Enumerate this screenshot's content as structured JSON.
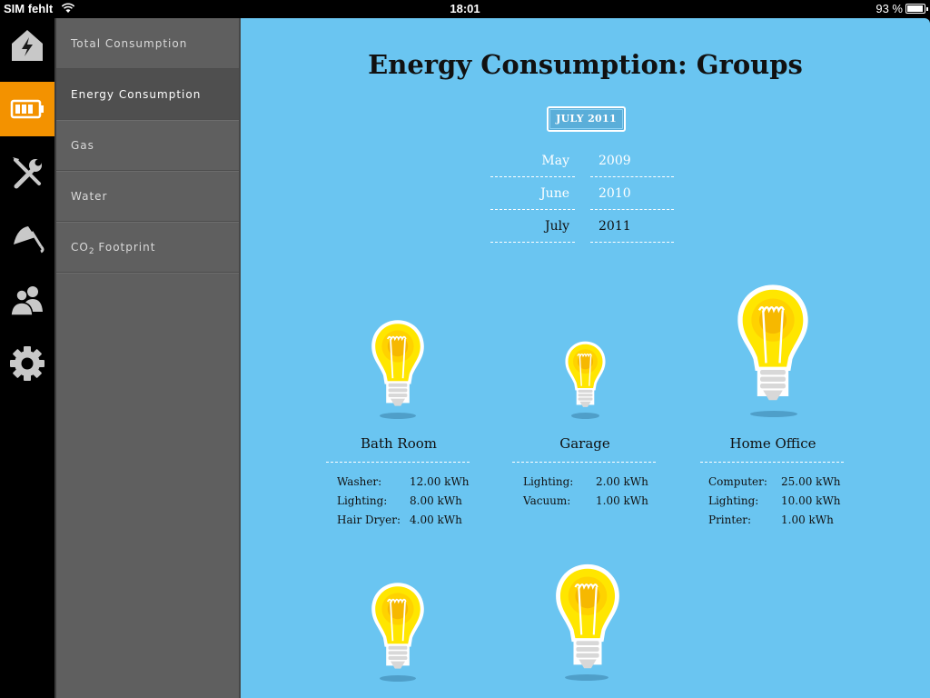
{
  "status_bar": {
    "carrier": "SIM fehlt",
    "time": "18:01",
    "battery_percent": "93 %",
    "battery_level": 0.93
  },
  "icon_rail": {
    "items": [
      {
        "icon": "house-lightning-icon",
        "active": false
      },
      {
        "icon": "battery-icon",
        "active": true
      },
      {
        "icon": "tools-icon",
        "active": false
      },
      {
        "icon": "shower-icon",
        "active": false
      },
      {
        "icon": "users-icon",
        "active": false
      },
      {
        "icon": "gear-icon",
        "active": false
      }
    ],
    "accent_color": "#f39200"
  },
  "submenu": {
    "items": [
      {
        "label": "Total Consumption",
        "active": false
      },
      {
        "label": "Energy Consumption",
        "active": true
      },
      {
        "label": "Gas",
        "active": false
      },
      {
        "label": "Water",
        "active": false
      },
      {
        "label_main": "CO",
        "label_sub": "2",
        "label_rest": " Footprint",
        "active": false
      }
    ]
  },
  "content": {
    "background_color": "#6ac5f1",
    "title": "Energy Consumption: Groups",
    "selected_period_button": "JULY 2011",
    "picker": {
      "rows": [
        {
          "month": "May",
          "year": "2009"
        },
        {
          "month": "June",
          "year": "2010"
        },
        {
          "month": "July",
          "year": "2011",
          "selected": true
        }
      ]
    },
    "groups": [
      {
        "name": "Bath Room",
        "items": [
          {
            "label": "Washer:",
            "value": "12.00 kWh"
          },
          {
            "label": "Lighting:",
            "value": "8.00 kWh"
          },
          {
            "label": "Hair Dryer:",
            "value": "4.00 kWh"
          }
        ]
      },
      {
        "name": "Garage",
        "items": [
          {
            "label": "Lighting:",
            "value": "2.00 kWh"
          },
          {
            "label": "Vacuum:",
            "value": "1.00 kWh"
          }
        ]
      },
      {
        "name": "Home Office",
        "items": [
          {
            "label": "Computer:",
            "value": "25.00 kWh"
          },
          {
            "label": "Lighting:",
            "value": "10.00 kWh"
          },
          {
            "label": "Printer:",
            "value": "1.00 kWh"
          }
        ]
      }
    ],
    "bulb_colors": {
      "outer": "#ffe600",
      "middle": "#ffd200",
      "inner": "#f6b800",
      "outline": "#ffffff"
    }
  }
}
